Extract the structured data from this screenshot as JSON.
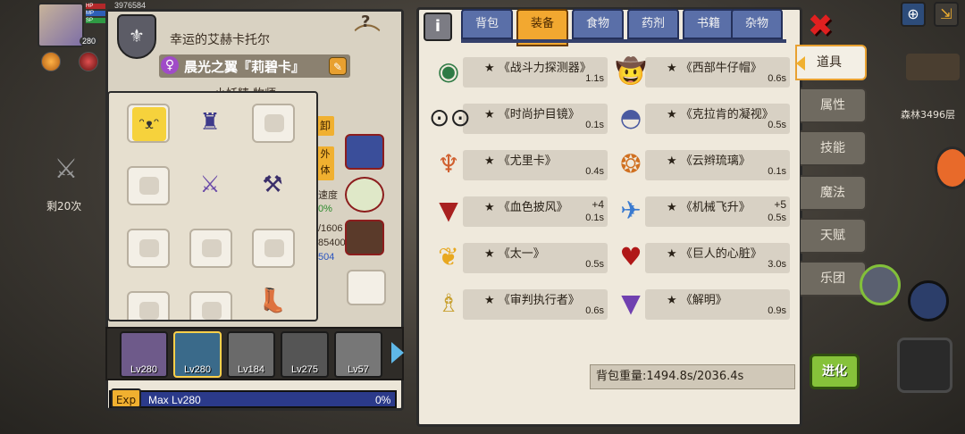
{
  "hud": {
    "hp_label": "HP",
    "mp_label": "MP",
    "sp_label": "SP",
    "gold": "3976584",
    "level": "280",
    "remaining": "剩20次"
  },
  "character": {
    "title": "幸运的艾赫卡托尔",
    "name": "晨光之翼『莉碧卡』",
    "gender_symbol": "♀",
    "subclass": "小妖精 牧师",
    "side_button_1": "卸",
    "side_button_2": "外体",
    "stat_label": "速度",
    "stat_pct": "0%",
    "stat_1": "/1606",
    "stat_2": "85400",
    "stat_3": "504"
  },
  "party": {
    "members": [
      {
        "level": "Lv280",
        "selected": false
      },
      {
        "level": "Lv280",
        "selected": true
      },
      {
        "level": "Lv184",
        "selected": false
      },
      {
        "level": "Lv275",
        "selected": false
      },
      {
        "level": "Lv57",
        "selected": false
      }
    ]
  },
  "exp": {
    "tag": "Exp",
    "label": "Max Lv280",
    "percent": "0%"
  },
  "tabs": [
    {
      "label": "背包",
      "active": false
    },
    {
      "label": "装备",
      "active": true
    },
    {
      "label": "食物",
      "active": false
    },
    {
      "label": "药剂",
      "active": false
    },
    {
      "label": "书籍",
      "active": false
    },
    {
      "label": "杂物",
      "active": false
    }
  ],
  "items": [
    {
      "name": "《战斗力探测器》",
      "star": "★",
      "weight": "1.1s",
      "plus": "",
      "icon": "scouter-icon"
    },
    {
      "name": "《西部牛仔帽》",
      "star": "★",
      "weight": "0.6s",
      "plus": "",
      "icon": "cowboy-hat-icon"
    },
    {
      "name": "《时尚护目镜》",
      "star": "★",
      "weight": "0.1s",
      "plus": "",
      "icon": "goggles-icon"
    },
    {
      "name": "《克拉肯的凝视》",
      "star": "★",
      "weight": "0.5s",
      "plus": "",
      "icon": "kraken-gaze-icon"
    },
    {
      "name": "《尤里卡》",
      "star": "★",
      "weight": "0.4s",
      "plus": "",
      "icon": "eureka-necklace-icon"
    },
    {
      "name": "《云辫琉璃》",
      "star": "★",
      "weight": "0.1s",
      "plus": "",
      "icon": "glass-orb-icon"
    },
    {
      "name": "《血色披风》",
      "star": "★",
      "weight": "0.1s",
      "plus": "+4",
      "icon": "blood-cape-icon"
    },
    {
      "name": "《机械飞升》",
      "star": "★",
      "weight": "0.5s",
      "plus": "+5",
      "icon": "mech-wing-icon"
    },
    {
      "name": "《太一》",
      "star": "★",
      "weight": "0.5s",
      "plus": "",
      "icon": "golden-wing-icon"
    },
    {
      "name": "《巨人的心脏》",
      "star": "★",
      "weight": "3.0s",
      "plus": "",
      "icon": "giant-heart-icon"
    },
    {
      "name": "《审判执行者》",
      "star": "★",
      "weight": "0.6s",
      "plus": "",
      "icon": "judge-robe-icon"
    },
    {
      "name": "《解明》",
      "star": "★",
      "weight": "0.9s",
      "plus": "",
      "icon": "purple-cape-icon"
    }
  ],
  "bag_weight": "背包重量:1494.8s/2036.4s",
  "side_nav": [
    {
      "label": "道具",
      "active": true
    },
    {
      "label": "属性",
      "active": false
    },
    {
      "label": "技能",
      "active": false
    },
    {
      "label": "魔法",
      "active": false
    },
    {
      "label": "天赋",
      "active": false
    },
    {
      "label": "乐团",
      "active": false
    }
  ],
  "map_label": "森林3496层",
  "evolve_label": "进化",
  "colors": {
    "accent": "#f2a830",
    "tab_blue": "#5a6fa8",
    "close_red": "#e02020",
    "evolve_green": "#86c23a"
  }
}
